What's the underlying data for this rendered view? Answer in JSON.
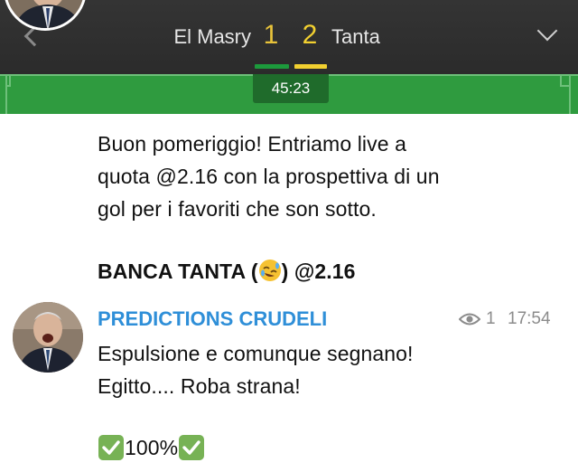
{
  "match": {
    "home_team": "El Masry",
    "home_score": "1",
    "away_score": "2",
    "away_team": "Tanta",
    "clock": "45:23",
    "colors": {
      "home_pip": "#1c9a3c",
      "away_pip": "#f2d030",
      "pitch": "#2f9b3f"
    }
  },
  "post": {
    "line1": "Buon pomeriggio! Entriamo live  a",
    "line2": "quota @2.16 con la prospettiva di un",
    "line3": "gol per i favoriti che son sotto.",
    "bet_prefix": "BANCA TANTA (",
    "bet_suffix": ") @2.16"
  },
  "reply": {
    "author": "PREDICTIONS CRUDELI",
    "views": "1",
    "time": "17:54",
    "line1": "Espulsione e comunque segnano!",
    "line2": "Egitto.... Roba strana!",
    "result": "100%"
  },
  "icons": {
    "back": "chevron-left-icon",
    "expand": "chevron-down-icon",
    "laugh": "rolling-laughing-emoji-icon",
    "views": "eye-icon",
    "check": "check-mark-button-emoji-icon"
  },
  "colors": {
    "author": "#2f8fd8",
    "meta": "#8c8c8c",
    "check_green": "#77b255"
  }
}
